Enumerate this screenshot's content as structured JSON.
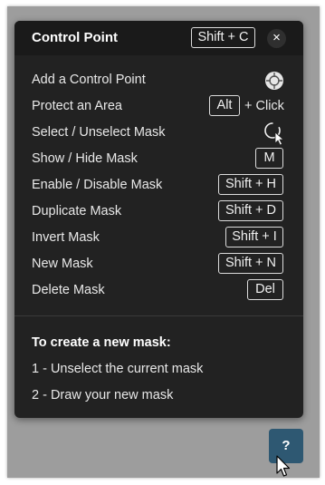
{
  "panel": {
    "title": "Control Point",
    "title_shortcut": "Shift + C",
    "close_glyph": "×"
  },
  "shortcuts": [
    {
      "label": "Add a Control Point",
      "icon": "control-point-icon"
    },
    {
      "label": "Protect an Area",
      "key": "Alt",
      "suffix": "+ Click"
    },
    {
      "label": "Select / Unselect Mask",
      "icon": "lasso-cursor-icon"
    },
    {
      "label": "Show / Hide Mask",
      "key": "M"
    },
    {
      "label": "Enable / Disable Mask",
      "key": "Shift + H"
    },
    {
      "label": "Duplicate Mask",
      "key": "Shift + D"
    },
    {
      "label": "Invert Mask",
      "key": "Shift + I"
    },
    {
      "label": "New Mask",
      "key": "Shift + N"
    },
    {
      "label": "Delete Mask",
      "key": "Del"
    }
  ],
  "tips": {
    "title": "To create a new mask:",
    "steps": [
      "1 - Unselect the current mask",
      "2 - Draw your new mask"
    ]
  },
  "help_button": {
    "label": "?"
  },
  "colors": {
    "panel_bg": "#222222",
    "header_bg": "#1a1a1a",
    "canvas_bg": "#9d9d9d",
    "help_bg": "#2e5872",
    "text": "#e8e8e8"
  }
}
